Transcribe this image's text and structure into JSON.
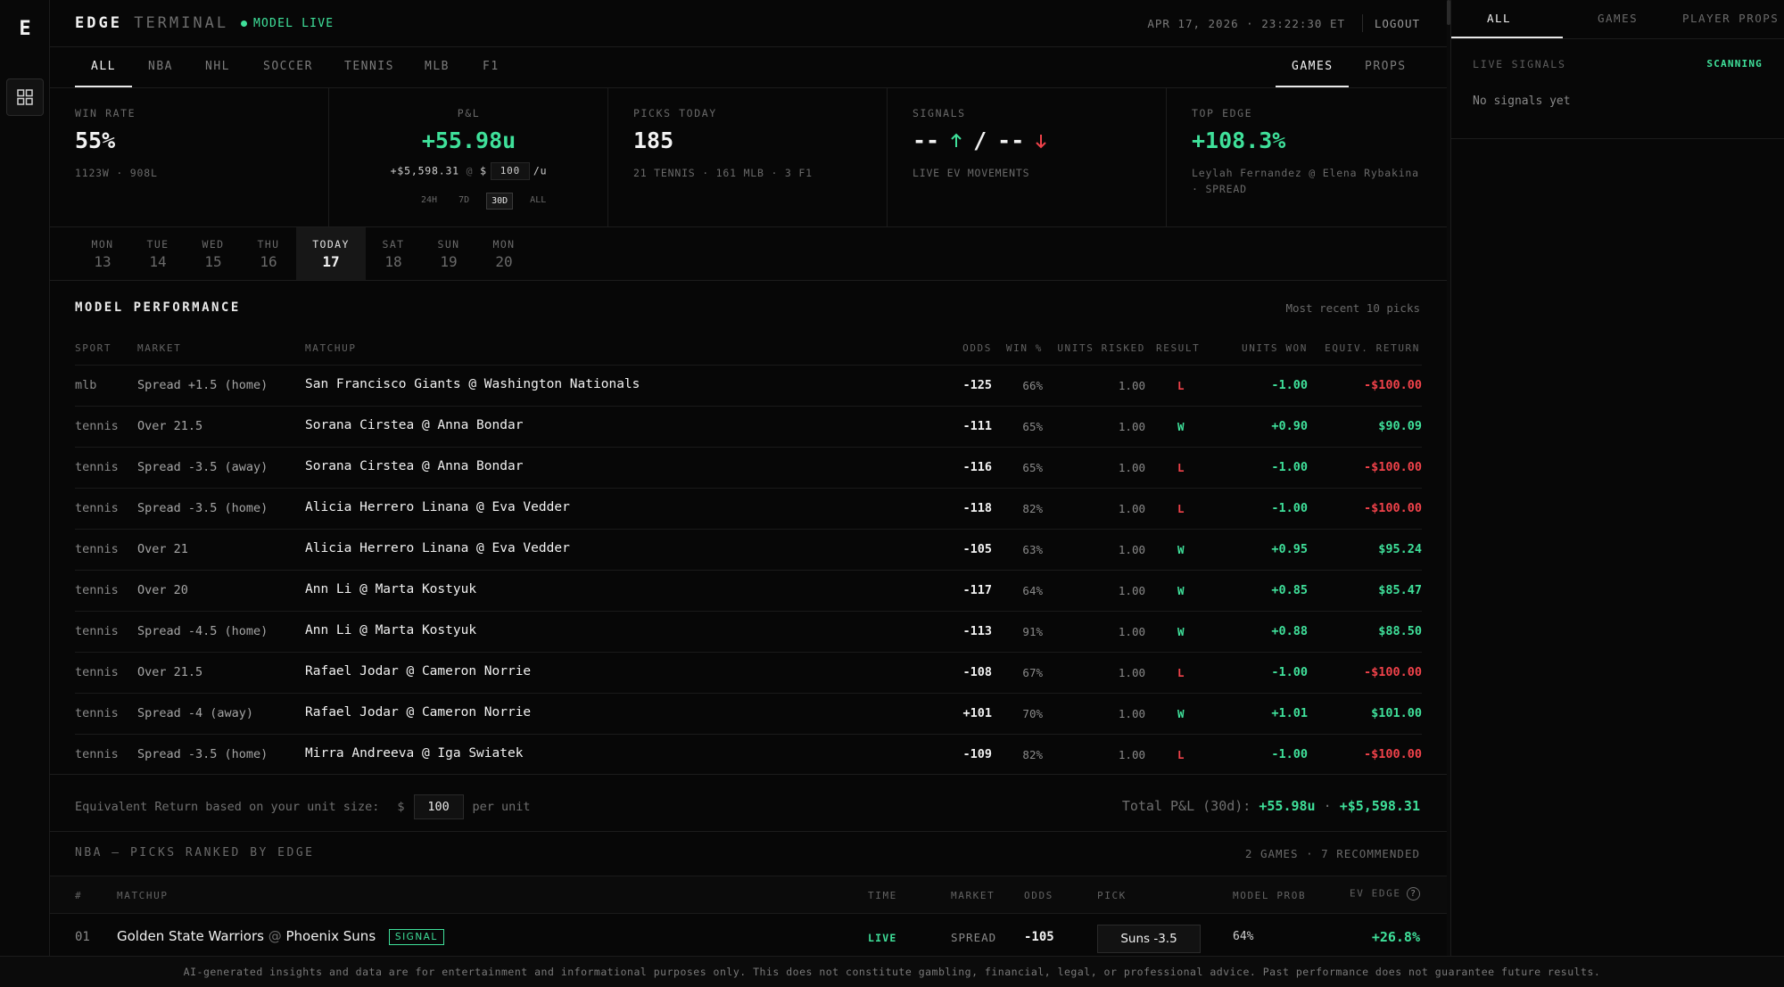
{
  "rail": {
    "logo": "E",
    "nav_icon": "grid-icon"
  },
  "header": {
    "brand_primary": "EDGE",
    "brand_secondary": "TERMINAL",
    "status": "MODEL LIVE",
    "datetime": "APR 17, 2026 · 23:22:30 ET",
    "logout": "LOGOUT"
  },
  "sport_tabs": [
    "ALL",
    "NBA",
    "NHL",
    "SOCCER",
    "TENNIS",
    "MLB",
    "F1"
  ],
  "active_sport": "ALL",
  "view_tabs": [
    "GAMES",
    "PROPS"
  ],
  "active_view": "GAMES",
  "stats": {
    "win_rate": {
      "label": "WIN RATE",
      "value": "55%",
      "sub": "1123W · 908L"
    },
    "pnl": {
      "label": "P&L",
      "value": "+55.98u",
      "dollars": "+$5,598.31",
      "at": "@",
      "currency": "$",
      "unit_value": "100",
      "per": "/u",
      "ranges": [
        "24H",
        "7D",
        "30D",
        "ALL"
      ],
      "active_range": "30D"
    },
    "picks_today": {
      "label": "PICKS TODAY",
      "value": "185",
      "sub": "21 TENNIS · 161 MLB · 3 F1"
    },
    "signals": {
      "label": "SIGNALS",
      "up_value": "--",
      "slash": "/",
      "down_value": "--",
      "sub": "LIVE EV MOVEMENTS"
    },
    "top_edge": {
      "label": "TOP EDGE",
      "value": "+108.3%",
      "sub_line1": "Leylah Fernandez @ Elena Rybakina",
      "sub_line2": "· SPREAD"
    }
  },
  "days": [
    {
      "name": "MON",
      "date": "13"
    },
    {
      "name": "TUE",
      "date": "14"
    },
    {
      "name": "WED",
      "date": "15"
    },
    {
      "name": "THU",
      "date": "16"
    },
    {
      "name": "TODAY",
      "date": "17"
    },
    {
      "name": "SAT",
      "date": "18"
    },
    {
      "name": "SUN",
      "date": "19"
    },
    {
      "name": "MON",
      "date": "20"
    }
  ],
  "active_day": "17",
  "performance": {
    "title": "MODEL PERFORMANCE",
    "note": "Most recent 10 picks",
    "columns": [
      "SPORT",
      "MARKET",
      "MATCHUP",
      "ODDS",
      "WIN %",
      "UNITS RISKED",
      "RESULT",
      "UNITS WON",
      "EQUIV. RETURN"
    ],
    "rows": [
      {
        "sport": "mlb",
        "market": "Spread +1.5 (home)",
        "matchup": "San Francisco Giants @ Washington Nationals",
        "odds": "-125",
        "win": "66%",
        "units": "1.00",
        "result": "L",
        "won": "-1.00",
        "ret": "-$100.00"
      },
      {
        "sport": "tennis",
        "market": "Over 21.5",
        "matchup": "Sorana Cirstea @ Anna Bondar",
        "odds": "-111",
        "win": "65%",
        "units": "1.00",
        "result": "W",
        "won": "+0.90",
        "ret": "$90.09"
      },
      {
        "sport": "tennis",
        "market": "Spread -3.5 (away)",
        "matchup": "Sorana Cirstea @ Anna Bondar",
        "odds": "-116",
        "win": "65%",
        "units": "1.00",
        "result": "L",
        "won": "-1.00",
        "ret": "-$100.00"
      },
      {
        "sport": "tennis",
        "market": "Spread -3.5 (home)",
        "matchup": "Alicia Herrero Linana @ Eva Vedder",
        "odds": "-118",
        "win": "82%",
        "units": "1.00",
        "result": "L",
        "won": "-1.00",
        "ret": "-$100.00"
      },
      {
        "sport": "tennis",
        "market": "Over 21",
        "matchup": "Alicia Herrero Linana @ Eva Vedder",
        "odds": "-105",
        "win": "63%",
        "units": "1.00",
        "result": "W",
        "won": "+0.95",
        "ret": "$95.24"
      },
      {
        "sport": "tennis",
        "market": "Over 20",
        "matchup": "Ann Li @ Marta Kostyuk",
        "odds": "-117",
        "win": "64%",
        "units": "1.00",
        "result": "W",
        "won": "+0.85",
        "ret": "$85.47"
      },
      {
        "sport": "tennis",
        "market": "Spread -4.5 (home)",
        "matchup": "Ann Li @ Marta Kostyuk",
        "odds": "-113",
        "win": "91%",
        "units": "1.00",
        "result": "W",
        "won": "+0.88",
        "ret": "$88.50"
      },
      {
        "sport": "tennis",
        "market": "Over 21.5",
        "matchup": "Rafael Jodar @ Cameron Norrie",
        "odds": "-108",
        "win": "67%",
        "units": "1.00",
        "result": "L",
        "won": "-1.00",
        "ret": "-$100.00"
      },
      {
        "sport": "tennis",
        "market": "Spread -4 (away)",
        "matchup": "Rafael Jodar @ Cameron Norrie",
        "odds": "+101",
        "win": "70%",
        "units": "1.00",
        "result": "W",
        "won": "+1.01",
        "ret": "$101.00"
      },
      {
        "sport": "tennis",
        "market": "Spread -3.5 (home)",
        "matchup": "Mirra Andreeva @ Iga Swiatek",
        "odds": "-109",
        "win": "82%",
        "units": "1.00",
        "result": "L",
        "won": "-1.00",
        "ret": "-$100.00"
      }
    ],
    "footer": {
      "label": "Equivalent Return based on your unit size:",
      "currency": "$",
      "unit_value": "100",
      "per_unit": "per unit",
      "total_label": "Total P&L (30d):",
      "total_units": "+55.98u",
      "sep": "·",
      "total_dollars": "+$5,598.31"
    }
  },
  "nba": {
    "title": "NBA — PICKS RANKED BY EDGE",
    "count": "2 GAMES · 7 RECOMMENDED",
    "columns": [
      "#",
      "MATCHUP",
      "TIME",
      "MARKET",
      "ODDS",
      "PICK",
      "MODEL PROB",
      "EV EDGE"
    ],
    "help_icon": "?",
    "rows": [
      {
        "rank": "01",
        "away": "Golden State Warriors",
        "at": "@",
        "home": "Phoenix Suns",
        "badge": "SIGNAL",
        "time": "LIVE",
        "market": "SPREAD",
        "odds": "-105",
        "pick": "Suns -3.5",
        "prob": "64%",
        "edge": "+26.8%"
      }
    ]
  },
  "right_panel": {
    "tabs": [
      "ALL",
      "GAMES",
      "PLAYER PROPS"
    ],
    "active_tab": "ALL",
    "signals_label": "LIVE SIGNALS",
    "status": "SCANNING",
    "empty": "No signals yet"
  },
  "disclaimer": "AI-generated insights and data are for entertainment and informational purposes only. This does not constitute gambling, financial, legal, or professional advice. Past performance does not guarantee future results.",
  "colors": {
    "accent": "#3fe09a",
    "negative": "#f0424a",
    "background": "#070707",
    "border": "#1c1c1c"
  }
}
